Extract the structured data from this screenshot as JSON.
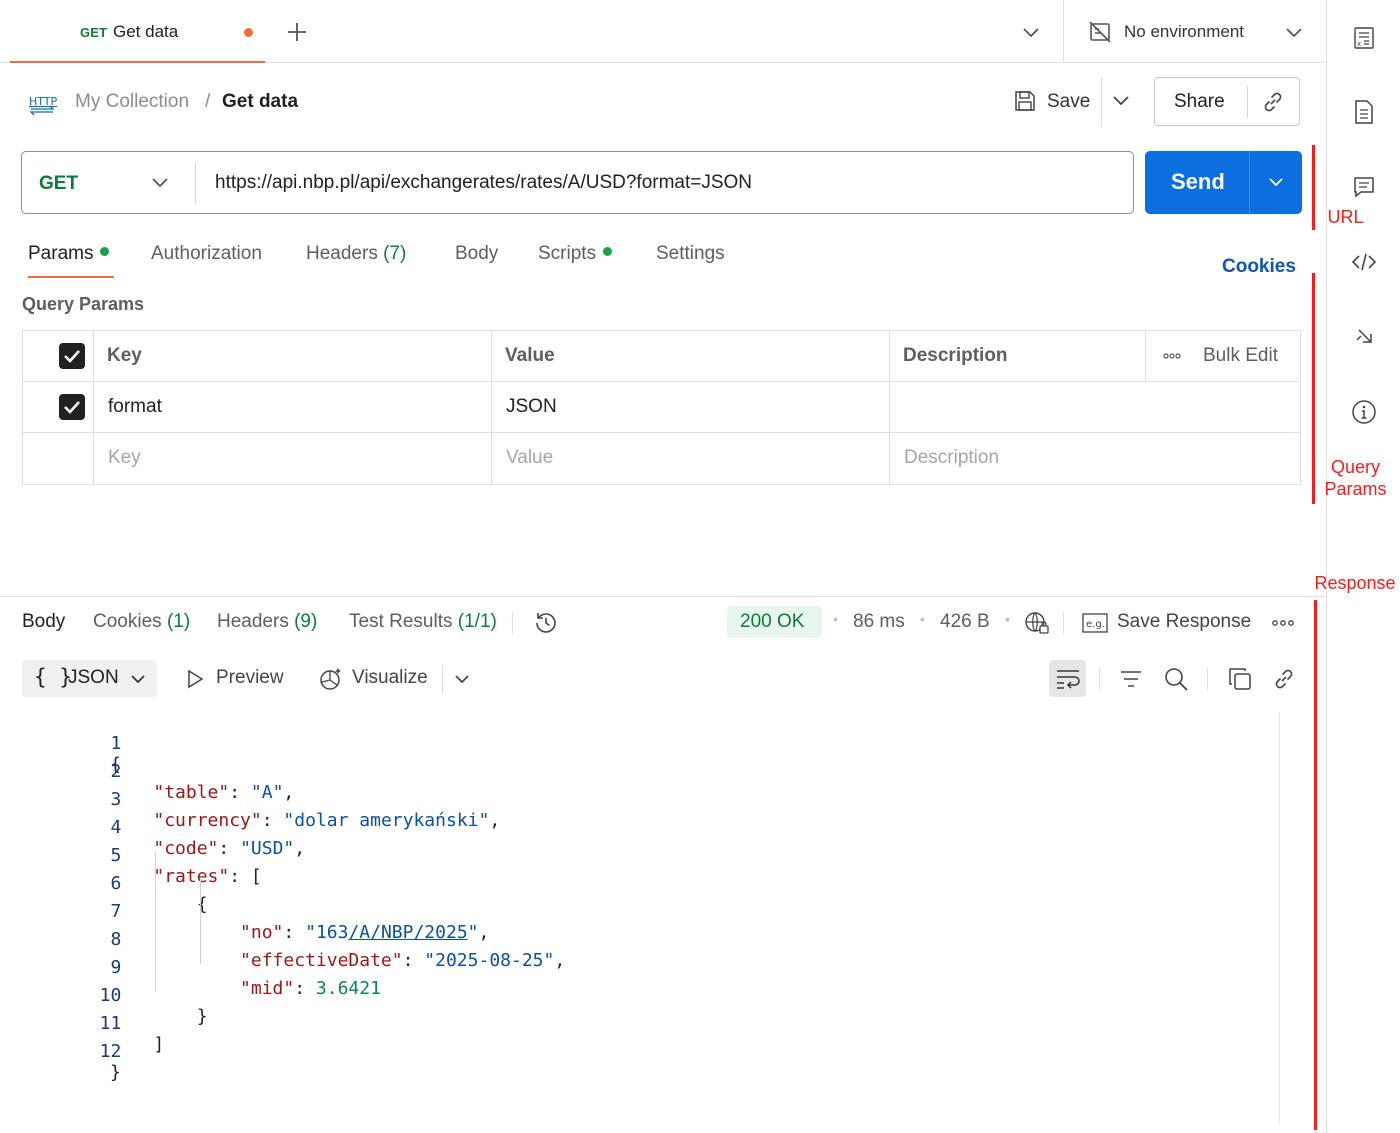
{
  "tab": {
    "method": "GET",
    "label": "Get data"
  },
  "environment": {
    "label": "No environment"
  },
  "breadcrumb": {
    "protocol_icon": "http-icon",
    "parent": "My Collection",
    "separator": "/",
    "current": "Get data"
  },
  "actions": {
    "save_label": "Save",
    "share_label": "Share"
  },
  "request": {
    "method": "GET",
    "url": "https://api.nbp.pl/api/exchangerates/rates/A/USD?format=JSON",
    "send_label": "Send"
  },
  "request_tabs": {
    "params": "Params",
    "authorization": "Authorization",
    "headers": "Headers",
    "headers_count": "(7)",
    "body": "Body",
    "scripts": "Scripts",
    "settings": "Settings",
    "cookies": "Cookies"
  },
  "query_params": {
    "title": "Query Params",
    "columns": {
      "key": "Key",
      "value": "Value",
      "description": "Description",
      "bulk_edit": "Bulk Edit"
    },
    "rows": [
      {
        "key": "format",
        "value": "JSON",
        "description": ""
      }
    ],
    "placeholders": {
      "key": "Key",
      "value": "Value",
      "description": "Description"
    }
  },
  "annotations": {
    "url": "URL",
    "query_params_line1": "Query",
    "query_params_line2": "Params",
    "response": "Response"
  },
  "response_tabs": {
    "body": "Body",
    "cookies": "Cookies",
    "cookies_count": "(1)",
    "headers": "Headers",
    "headers_count": "(9)",
    "test_results": "Test Results",
    "test_results_count": "(1/1)"
  },
  "response_meta": {
    "status": "200 OK",
    "time": "86 ms",
    "size": "426 B",
    "save_response": "Save Response"
  },
  "response_toolbar": {
    "format_brace": "{ }",
    "format": "JSON",
    "preview": "Preview",
    "visualize": "Visualize"
  },
  "code": {
    "line_numbers": [
      "1",
      "2",
      "3",
      "4",
      "5",
      "6",
      "7",
      "8",
      "9",
      "10",
      "11",
      "12"
    ],
    "l1": "{",
    "table_key": "\"table\"",
    "table_val": "\"A\"",
    "currency_key": "\"currency\"",
    "currency_val": "\"dolar amerykański\"",
    "code_key": "\"code\"",
    "code_val": "\"USD\"",
    "rates_key": "\"rates\"",
    "rates_open": "[",
    "obj_open": "{",
    "no_key": "\"no\"",
    "no_q1": "\"",
    "no_val_a": "163",
    "no_val_b": "/A/NBP/2025",
    "no_q2": "\"",
    "date_key": "\"effectiveDate\"",
    "date_val": "\"2025-08-25\"",
    "mid_key": "\"mid\"",
    "mid_val": "3.6421",
    "obj_close": "}",
    "rates_close": "]",
    "l12": "}"
  },
  "colors": {
    "accent": "#f26b3a",
    "send": "#0b6fe0",
    "get": "#0a7d3e",
    "annotation": "#ff1a1a"
  }
}
